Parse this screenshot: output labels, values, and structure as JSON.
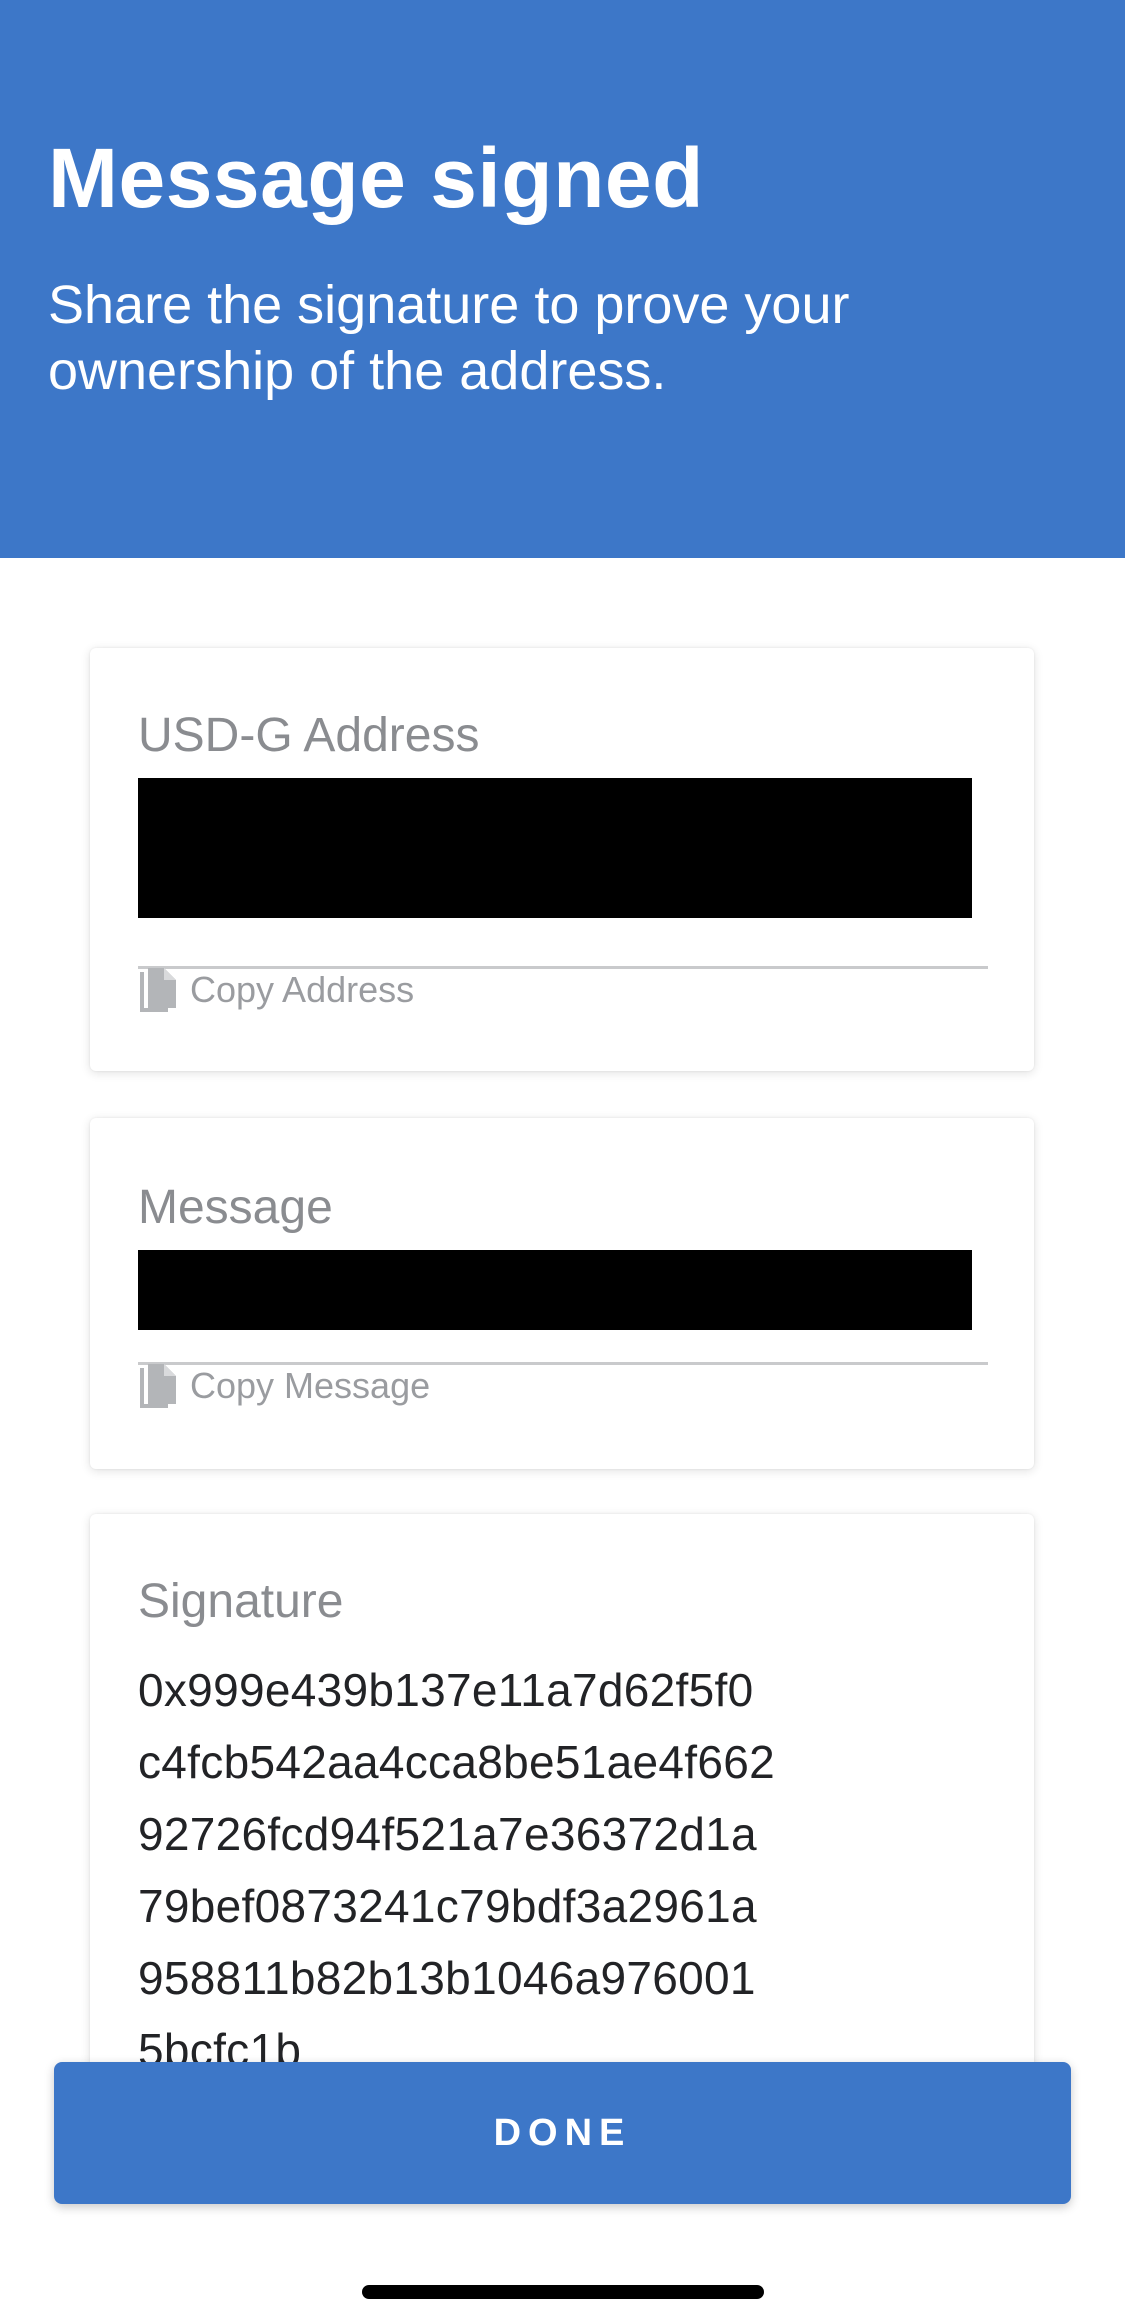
{
  "header": {
    "title": "Message signed",
    "subtitle": "Share the signature to prove your ownership of the address."
  },
  "address_card": {
    "label": "USD-G Address",
    "copy_label": "Copy Address",
    "icon": "copy-icon"
  },
  "message_card": {
    "label": "Message",
    "copy_label": "Copy Message",
    "icon": "copy-icon"
  },
  "signature_card": {
    "label": "Signature",
    "lines": [
      "0x999e439b137e11a7d62f5f0",
      "c4fcb542aa4cca8be51ae4f662",
      "92726fcd94f521a7e36372d1a",
      "79bef0873241c79bdf3a2961a",
      "958811b82b13b1046a976001",
      "5bcfc1b"
    ]
  },
  "actions": {
    "done_label": "DONE"
  },
  "colors": {
    "primary": "#3d77c8",
    "label_gray": "#8a8c90",
    "text_dark": "#222326",
    "redaction": "#000000"
  }
}
